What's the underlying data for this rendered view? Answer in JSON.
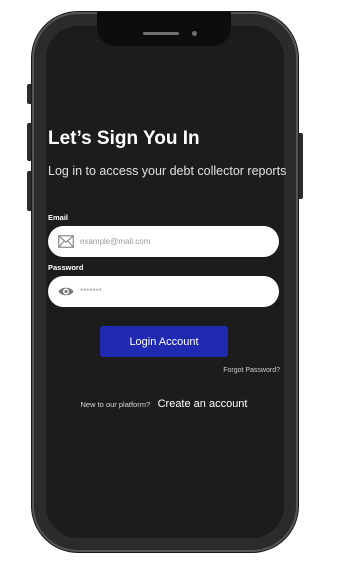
{
  "signin": {
    "title": "Let’s Sign You In",
    "subtitle": "Log in to access your debt collector reports",
    "email": {
      "label": "Email",
      "placeholder": "example@mail.com",
      "value": "",
      "icon": "envelope-icon"
    },
    "password": {
      "label": "Password",
      "placeholder": "*******",
      "value": "",
      "icon": "eye-icon"
    },
    "login_button": "Login Account",
    "forgot_password": "Forgot Password?",
    "signup_prompt": "New to our platform?",
    "signup_link": "Create an account"
  },
  "colors": {
    "screen_background": "#1c1c1c",
    "primary_button": "#1f2ab1",
    "field_background": "#ffffff",
    "text_primary": "#ffffff"
  }
}
